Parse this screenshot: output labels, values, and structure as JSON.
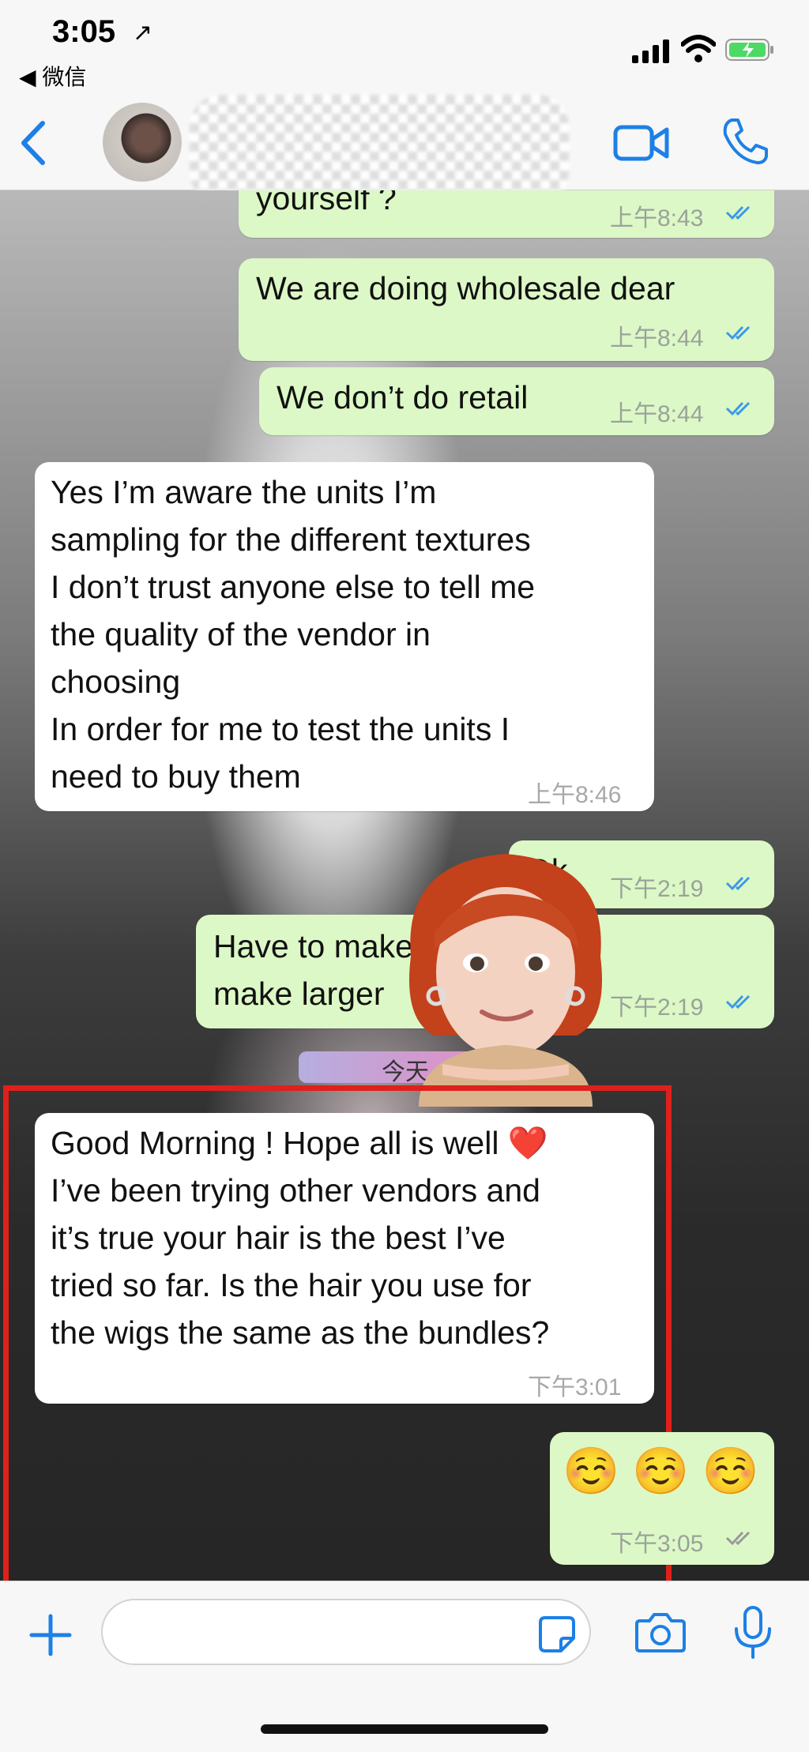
{
  "status_bar": {
    "time": "3:05",
    "location_arrow": "↗",
    "back_app": "◀ 微信"
  },
  "header": {
    "back_icon": "chevron-left-icon",
    "video_icon": "video-call-icon",
    "phone_icon": "phone-icon",
    "accent_color": "#1d80e6"
  },
  "messages": [
    {
      "id": "m1",
      "direction": "outgoing",
      "text": "yourself ?",
      "time": "上午8:43",
      "status": "read"
    },
    {
      "id": "m2",
      "direction": "outgoing",
      "text": "We are doing wholesale dear",
      "time": "上午8:44",
      "status": "read"
    },
    {
      "id": "m3",
      "direction": "outgoing",
      "text": "We don’t do retail",
      "time": "上午8:44",
      "status": "read"
    },
    {
      "id": "m4",
      "direction": "incoming",
      "text": "Yes I’m aware the units I’m\nsampling for the different textures\nI don’t trust anyone else to tell me\nthe quality of the vendor in\nchoosing\nIn order for me to test the units I\nneed to buy them",
      "time": "上午8:46"
    },
    {
      "id": "m5",
      "direction": "outgoing",
      "text": "Ok",
      "time": "下午2:19",
      "status": "read"
    },
    {
      "id": "m6",
      "direction": "outgoing",
      "text": "Have to make order to\nmake larger",
      "time": "下午2:19",
      "status": "read"
    },
    {
      "id": "m7",
      "direction": "incoming",
      "text": "Good Morning ! Hope all is well ❤️\nI’ve been trying other vendors and\nit’s true your hair is the best I’ve\ntried so far. Is the hair you use for\nthe wigs the same as the bundles?",
      "time": "下午3:01",
      "highlighted": true
    },
    {
      "id": "m8",
      "direction": "outgoing",
      "text": "☺️ ☺️ ☺️",
      "time": "下午3:05",
      "status": "delivered"
    }
  ],
  "date_separator": "今天",
  "colors": {
    "outgoing_bubble": "#dcf8c6",
    "incoming_bubble": "#ffffff",
    "highlight_border": "#e0201a",
    "read_ticks": "#3b9ae8"
  },
  "input_bar": {
    "plus_icon": "plus-icon",
    "sticker_icon": "sticker-icon",
    "camera_icon": "camera-icon",
    "mic_icon": "microphone-icon"
  }
}
